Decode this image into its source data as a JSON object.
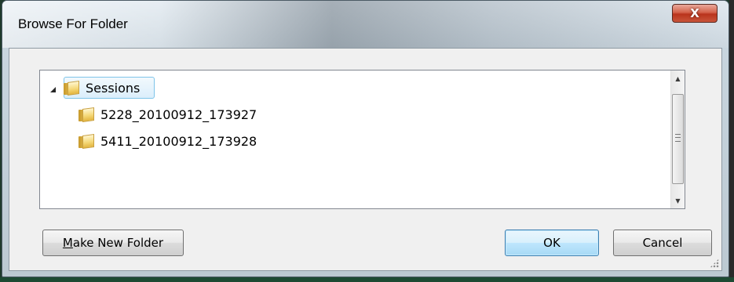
{
  "window": {
    "title": "Browse For Folder",
    "close_glyph": "X"
  },
  "tree": {
    "root": {
      "label": "Sessions",
      "icon": "folder-icon",
      "expanded": true,
      "selected": true
    },
    "children": [
      {
        "label": "5228_20100912_173927",
        "icon": "folder-icon"
      },
      {
        "label": "5411_20100912_173928",
        "icon": "folder-icon"
      }
    ]
  },
  "buttons": {
    "make_new_folder_prefix": "M",
    "make_new_folder_rest": "ake New Folder",
    "ok": "OK",
    "cancel": "Cancel"
  },
  "colors": {
    "selection_border": "#7ec4e9",
    "default_button_border": "#3c7fb1",
    "close_button": "#c9553b"
  }
}
